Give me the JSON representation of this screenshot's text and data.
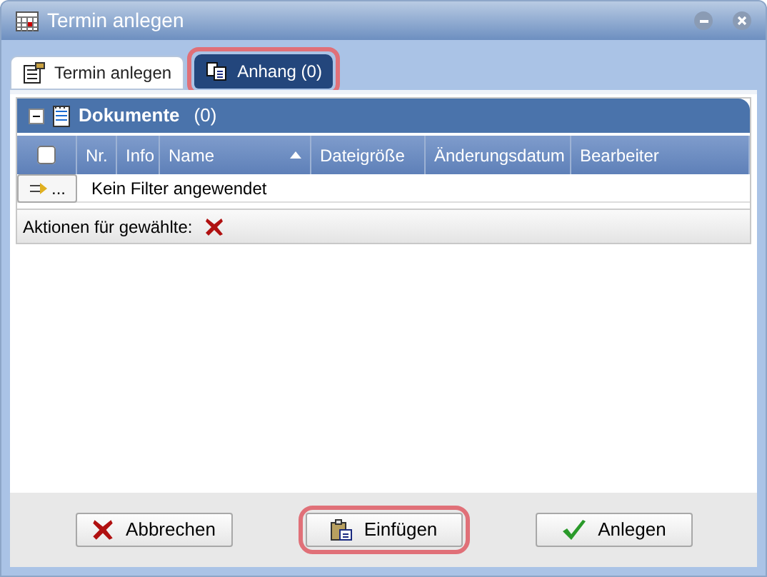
{
  "window": {
    "title": "Termin anlegen"
  },
  "tabs": [
    {
      "label": "Termin anlegen",
      "selected": false,
      "highlighted": false
    },
    {
      "label": "Anhang (0)",
      "selected": true,
      "highlighted": true
    }
  ],
  "panel": {
    "title": "Dokumente",
    "count": "(0)",
    "expanded": true
  },
  "table": {
    "select_all_checked": false,
    "columns": [
      {
        "label": "Nr.",
        "sorted": false
      },
      {
        "label": "Info",
        "sorted": false
      },
      {
        "label": "Name",
        "sorted": true
      },
      {
        "label": "Dateigröße",
        "sorted": false
      },
      {
        "label": "Änderungsdatum",
        "sorted": false
      },
      {
        "label": "Bearbeiter",
        "sorted": false
      }
    ],
    "filter_button": "...",
    "filter_text": "Kein Filter angewendet"
  },
  "actions_label": "Aktionen für gewählte:",
  "buttons": [
    {
      "label": "Abbrechen",
      "kind": "cancel",
      "highlighted": false
    },
    {
      "label": "Einfügen",
      "kind": "paste",
      "highlighted": true
    },
    {
      "label": "Anlegen",
      "kind": "ok",
      "highlighted": false
    }
  ]
}
